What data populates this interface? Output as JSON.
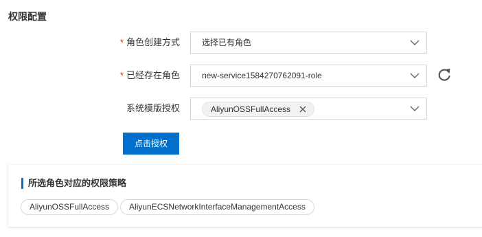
{
  "section_title": "权限配置",
  "form": {
    "role_creation": {
      "required_mark": "*",
      "label": "角色创建方式",
      "value": "选择已有角色"
    },
    "existing_role": {
      "required_mark": "*",
      "label": "已经存在角色",
      "value": "new-service1584270762091-role"
    },
    "template_auth": {
      "label": "系统模版授权",
      "tags": [
        "AliyunOSSFullAccess"
      ]
    },
    "authorize_button": "点击授权"
  },
  "policy_panel": {
    "title": "所选角色对应的权限策略",
    "policies": [
      "AliyunOSSFullAccess",
      "AliyunECSNetworkInterfaceManagementAccess"
    ]
  },
  "icons": {
    "dropdown": "chevron-down-icon",
    "refresh": "refresh-icon",
    "tag_remove": "close-icon"
  },
  "colors": {
    "primary": "#0070cc",
    "required": "#e0301e",
    "text": "#333333",
    "border": "#d6d6d6",
    "tag_bg": "#f2f2f2"
  }
}
